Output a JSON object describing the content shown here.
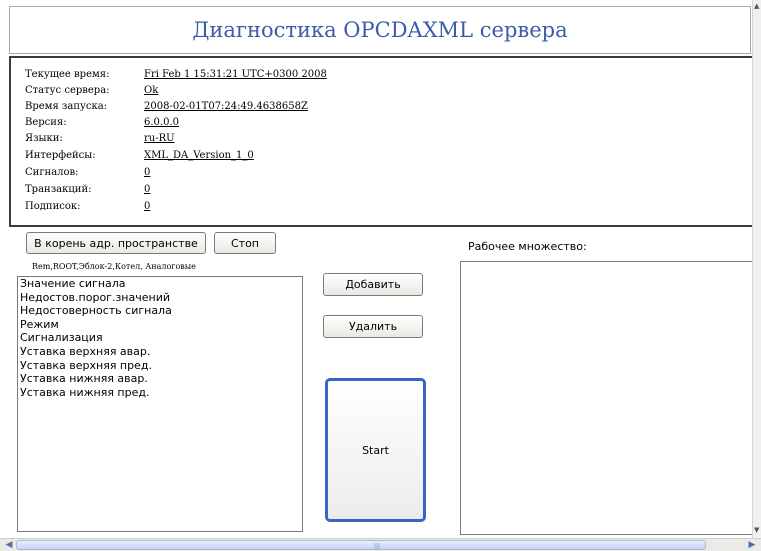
{
  "title": "Диагностика OPCDAXML сервера",
  "info": [
    {
      "label": "Текущее время:",
      "value": "Fri Feb 1 15:31:21 UTC+0300 2008"
    },
    {
      "label": "Статус сервера:",
      "value": "Ok"
    },
    {
      "label": "Время запуска:",
      "value": "2008-02-01T07:24:49.4638658Z"
    },
    {
      "label": "Версия:",
      "value": "6.0.0.0"
    },
    {
      "label": "Языки:",
      "value": "ru-RU"
    },
    {
      "label": "Интерфейсы:",
      "value": "XML_DA_Version_1_0"
    },
    {
      "label": "Сигналов:",
      "value": "0"
    },
    {
      "label": "Транзакций:",
      "value": "0"
    },
    {
      "label": "Подписок:",
      "value": "0"
    }
  ],
  "buttons": {
    "root": "В корень адр. пространстве",
    "stop": "Стоп",
    "add": "Добавить",
    "delete": "Удалить",
    "start": "Start"
  },
  "path": "Rem,ROOT,Эблок-2,Котел, Аналоговые",
  "list_items": [
    "Значение сигнала",
    "Недостов.порог.значений",
    "Недостоверность сигнала",
    "Режим",
    "Сигнализация",
    "Уставка верхняя авар.",
    "Уставка верхняя пред.",
    "Уставка нижняя авар.",
    "Уставка нижняя пред."
  ],
  "working_set_label": "Рабочее множество:",
  "icons": {
    "scroll_left": "arrow-left-icon",
    "scroll_right": "arrow-right-icon",
    "scroll_up": "arrow-up-icon",
    "scroll_down": "arrow-down-icon"
  }
}
